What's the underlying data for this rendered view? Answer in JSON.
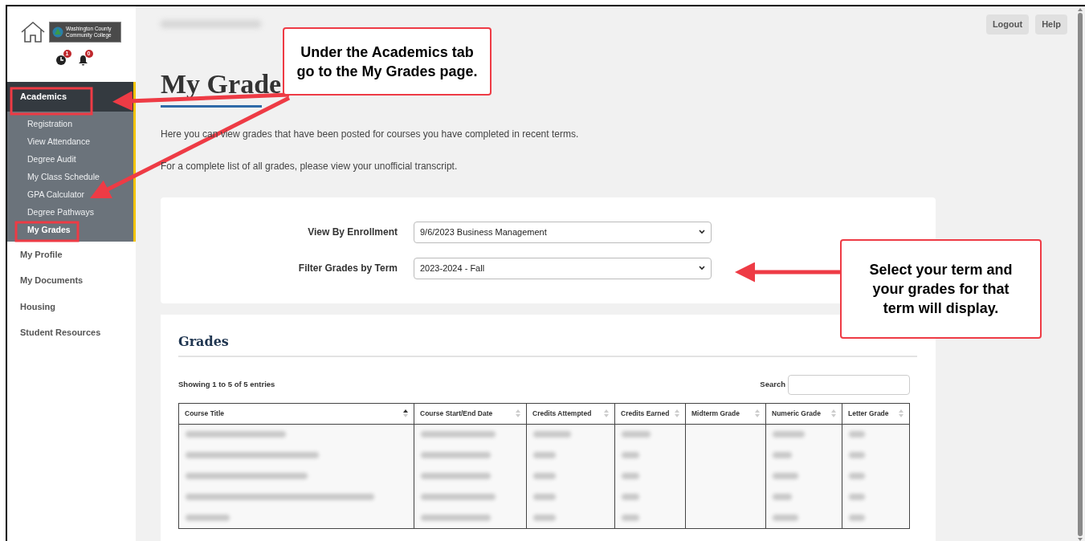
{
  "logo": {
    "line_1": "Washington County",
    "line_2": "Community College"
  },
  "notifications": [
    {
      "kind": "clock",
      "count": "1"
    },
    {
      "kind": "bell",
      "count": "0"
    }
  ],
  "sidebar": {
    "items": [
      {
        "label": "Academics",
        "selected": true,
        "expanded": true,
        "children": [
          {
            "label": "Registration",
            "selected": false
          },
          {
            "label": "View Attendance",
            "selected": false
          },
          {
            "label": "Degree Audit",
            "selected": false
          },
          {
            "label": "My Class Schedule",
            "selected": false
          },
          {
            "label": "GPA Calculator",
            "selected": false
          },
          {
            "label": "Degree Pathways",
            "selected": false
          },
          {
            "label": "My Grades",
            "selected": true
          }
        ]
      },
      {
        "label": "My Profile",
        "selected": false,
        "expanded": false
      },
      {
        "label": "My Documents",
        "selected": false,
        "expanded": false
      },
      {
        "label": "Housing",
        "selected": false,
        "expanded": false
      },
      {
        "label": "Student Resources",
        "selected": false,
        "expanded": false
      }
    ]
  },
  "header_buttons": [
    "Logout",
    "Help"
  ],
  "page": {
    "title": "My Grade",
    "intro": "Here you can view grades that have been posted for courses you have completed in recent terms.",
    "transcript_note": "For a complete list of all grades, please view your unofficial transcript."
  },
  "filters": [
    {
      "label": "View By Enrollment",
      "value": "9/6/2023 Business Management"
    },
    {
      "label": "Filter Grades by Term",
      "value": "2023-2024 - Fall"
    }
  ],
  "grades": {
    "title": "Grades",
    "info": "Showing 1 to 5 of 5 entries",
    "search_label": "Search",
    "columns": [
      {
        "label": "Course Title",
        "sorted": true
      },
      {
        "label": "Course Start/End Date",
        "sorted": false
      },
      {
        "label": "Credits Attempted",
        "sorted": false
      },
      {
        "label": "Credits Earned",
        "sorted": false
      },
      {
        "label": "Midterm Grade",
        "sorted": false
      },
      {
        "label": "Numeric Grade",
        "sorted": false
      },
      {
        "label": "Letter Grade",
        "sorted": false
      }
    ],
    "rows": [
      {
        "kind": "redacted"
      },
      {
        "kind": "redacted"
      },
      {
        "kind": "redacted"
      },
      {
        "kind": "redacted"
      },
      {
        "kind": "redacted"
      }
    ]
  },
  "annotations": [
    {
      "text": "Under the Academics tab go to the My Grades page."
    },
    {
      "text": "Select your term and your grades for that term will display."
    }
  ]
}
